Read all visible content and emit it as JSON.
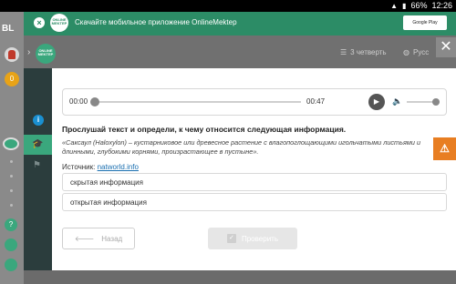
{
  "status_bar": {
    "time": "12:26",
    "battery": "66%"
  },
  "rail": {
    "logo": "BL",
    "coin_label": "0",
    "help_label": "?"
  },
  "banner": {
    "logo_text": "ONLINE MEKTEP",
    "text": "Скачайте мобильное приложение OnlineMektep",
    "store_label": "Google Play"
  },
  "header": {
    "logo_text": "ONLINE MEKTEP",
    "quarter": "3 четверть",
    "language": "Русс"
  },
  "audio": {
    "current_time": "00:00",
    "duration": "00:47",
    "progress": 0,
    "volume": 0.9
  },
  "question": {
    "title": "Прослушай текст и определи, к чему относится следующая информация.",
    "quote": "«Саксаул (Haloxylon) – кустарниковое или древесное растение с влагопоглощающими игольчатыми листьями и длинными, глубокими корнями, произрастающее в пустыне».",
    "source_label": "Источник:",
    "source_link": "natworld.info"
  },
  "answers": [
    "скрытая информация",
    "открытая информация"
  ],
  "buttons": {
    "back": "Назад",
    "check": "Проверить"
  },
  "colors": {
    "accent": "#3aa77d",
    "banner": "#2c8c66",
    "warning": "#e87e22",
    "info": "#1a8fd0"
  }
}
